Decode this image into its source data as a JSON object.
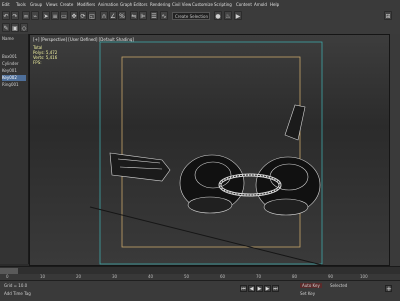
{
  "menubar": {
    "items": [
      "Edit",
      "Tools",
      "Group",
      "Views",
      "Create",
      "Modifiers",
      "Animation",
      "Graph Editors",
      "Rendering",
      "Civil View",
      "Customize",
      "Scripting",
      "Content",
      "Arnold",
      "Help"
    ]
  },
  "toolbar": {
    "dropdown_label": "Create Selection Se"
  },
  "viewport": {
    "label": "[+] [Perspective] [User Defined] [Default Shading]",
    "stats_total_label": "Total",
    "stats_polys": "Polys: 5,472",
    "stats_verts": "Verts: 5,416",
    "fps": "FPS:"
  },
  "left_panel": {
    "rows": [
      "Name",
      "Box001",
      "Cylinder",
      "Key001",
      "Key002",
      "Ring001"
    ],
    "selected_index": 4
  },
  "status": {
    "coords": "Grid = 10.0",
    "time": "Add Time Tag",
    "auto_key": "Auto Key",
    "selected": "Selected",
    "set_key": "Set Key"
  },
  "timeline": {
    "frame_labels": [
      "0",
      "10",
      "20",
      "30",
      "40",
      "50",
      "60",
      "70",
      "80",
      "90",
      "100"
    ]
  },
  "colors": {
    "accent_selected": "#4e6f9a",
    "viewport_frame_outer": "#3fa7a8",
    "viewport_frame_inner": "#c7a56a",
    "mesh": "#d9d9d9"
  }
}
